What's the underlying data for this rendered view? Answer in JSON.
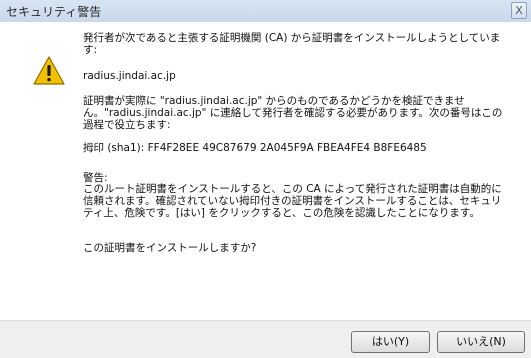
{
  "window": {
    "title": "セキュリティ警告",
    "close_glyph": "X"
  },
  "message": {
    "intro": "発行者が次であると主張する証明機関 (CA) から証明書をインストールしようとしています:",
    "host": "radius.jindai.ac.jp",
    "verify": "証明書が実際に \"radius.jindai.ac.jp\" からのものであるかどうかを検証できません。\"radius.jindai.ac.jp\" に連絡して発行者を確認する必要があります。次の番号はこの過程で役立ちます:",
    "thumbprint": "拇印 (sha1): FF4F28EE 49C87679 2A045F9A FBEA4FE4 B8FE6485",
    "warning_heading": "警告:",
    "warning_body": "このルート証明書をインストールすると、この CA によって発行された証明書は自動的に信頼されます。確認されていない拇印付きの証明書をインストールすることは、セキュリティ上、危険です。[はい] をクリックすると、この危険を認識したことになります。",
    "question": "この証明書をインストールしますか?"
  },
  "buttons": {
    "yes": "はい(Y)",
    "no": "いいえ(N)"
  },
  "icon": {
    "name": "warning-icon",
    "color": "#f2c200"
  }
}
